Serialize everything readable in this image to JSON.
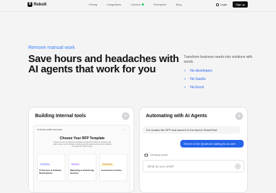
{
  "nav": {
    "brand": "Rebolt",
    "brand_mark": "R",
    "links": [
      "Pricing",
      "Integrations",
      "Careers",
      "Enterprise",
      "Blog"
    ],
    "login": "Login",
    "signup": "Sign up"
  },
  "hero": {
    "tagline": "Remove manual work",
    "headline": "Save hours and headaches with AI agents that work for you",
    "description": "Transform business needs into solutions with words.",
    "checks": [
      "No developers",
      "No SaaSs",
      "No Excel"
    ]
  },
  "card_left": {
    "title": "Building Internal tools",
    "inner_header": "AI Powered RFP Generator",
    "inner_icons": "☆ ⋯",
    "inner_title": "Choose Your RFP Template",
    "inner_subtitle": "Select from our AI-optimized templates designed for different industries and project types. Each template includes auto-generated sections and intelligent prompting for faster results.",
    "templates": [
      {
        "badge": "Technology",
        "label": "IT Services & Software Development"
      },
      {
        "badge": "Marketing",
        "label": "Marketing & Advertising Services"
      },
      {
        "badge": "Construction",
        "label": "Construction & Infra..."
      }
    ]
  },
  "card_right": {
    "title": "Automating with AI Agents",
    "message_in": "I've created the RFP and saved it in the team's SharePoint",
    "message_out": "Send it to the @outlook mailing list as well",
    "sending": "Sending email",
    "input_placeholder": "What do you need?"
  }
}
